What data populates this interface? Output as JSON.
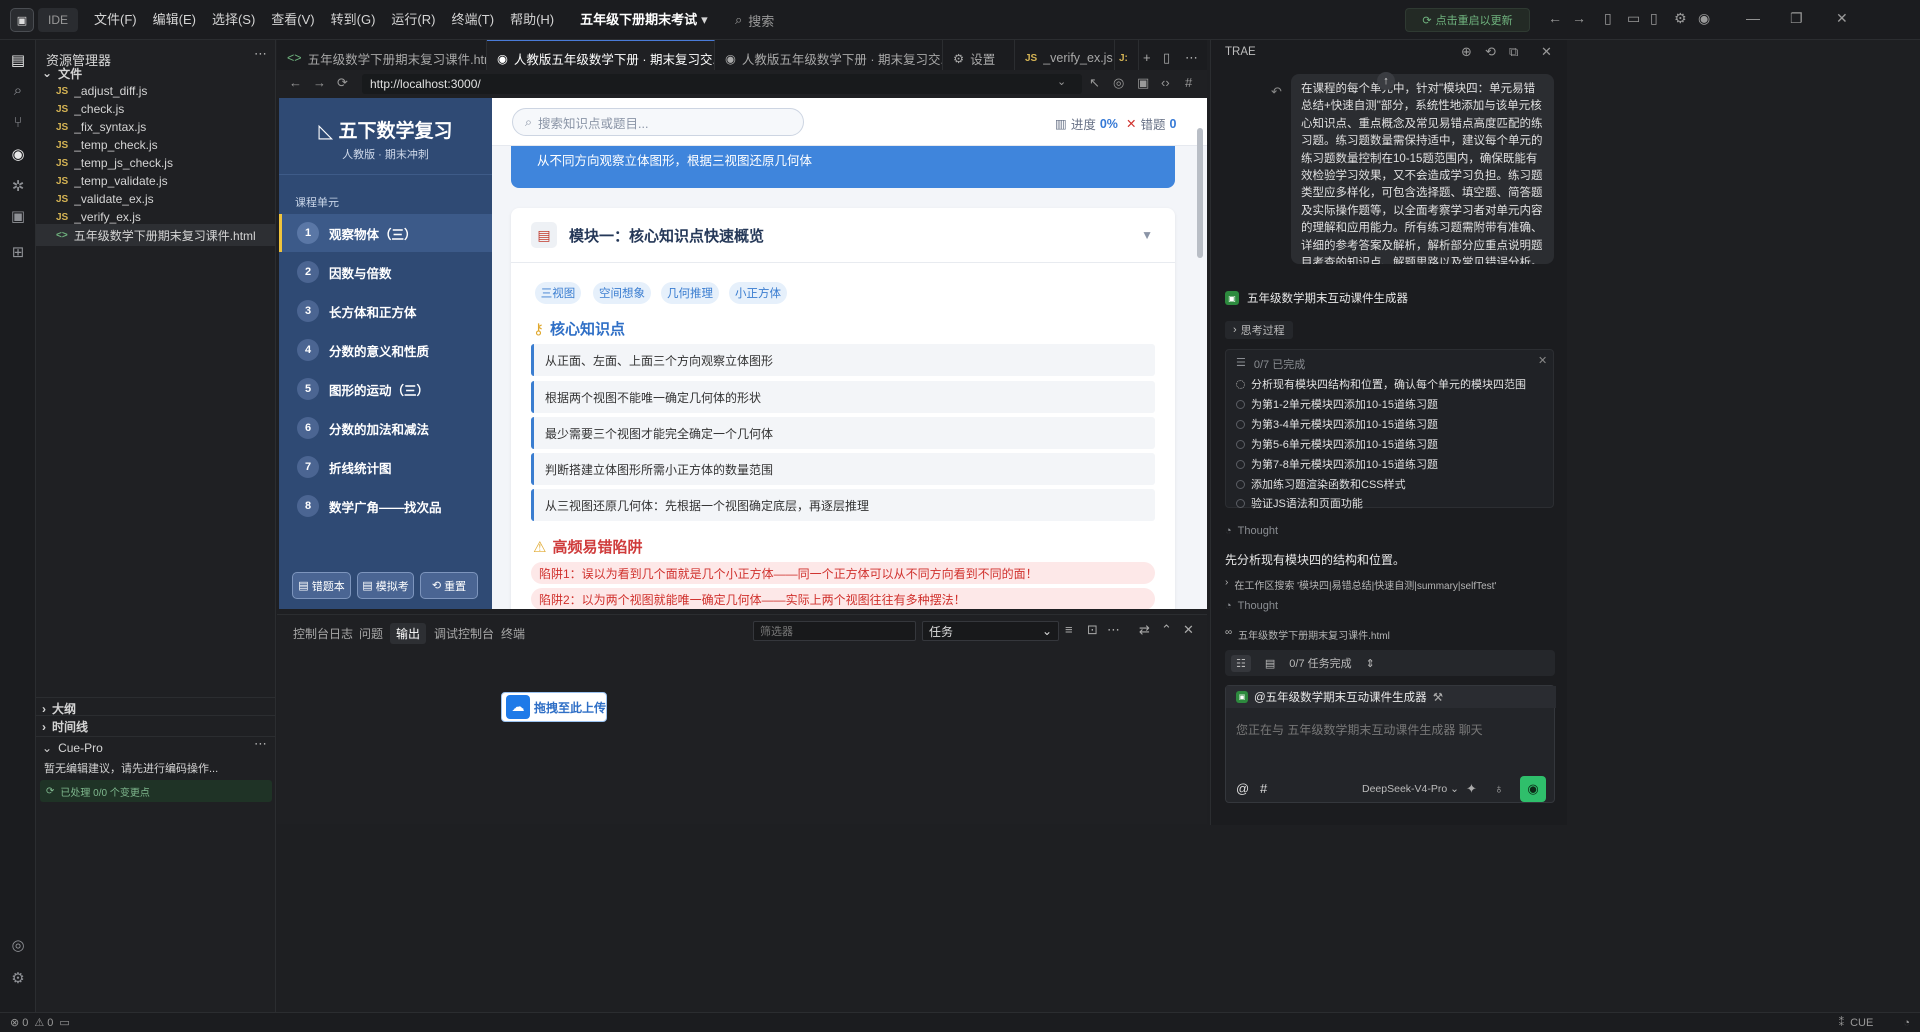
{
  "titlebar": {
    "logo": "▣",
    "ide_label": "IDE",
    "menu": [
      "文件(F)",
      "编辑(E)",
      "选择(S)",
      "查看(V)",
      "转到(G)",
      "运行(R)",
      "终端(T)",
      "帮助(H)"
    ],
    "workspace": "五年级下册期末考试",
    "search_placeholder": "搜索",
    "update_label": "点击重启以更新"
  },
  "explorer": {
    "title": "资源管理器",
    "root": "文件",
    "files": [
      {
        "icon": "JS",
        "name": "_adjust_diff.js"
      },
      {
        "icon": "JS",
        "name": "_check.js"
      },
      {
        "icon": "JS",
        "name": "_fix_syntax.js"
      },
      {
        "icon": "JS",
        "name": "_temp_check.js"
      },
      {
        "icon": "JS",
        "name": "_temp_js_check.js"
      },
      {
        "icon": "JS",
        "name": "_temp_validate.js"
      },
      {
        "icon": "JS",
        "name": "_validate_ex.js"
      },
      {
        "icon": "JS",
        "name": "_verify_ex.js"
      },
      {
        "icon": "<>",
        "name": "五年级数学下册期末复习课件.html"
      }
    ],
    "outline": "大纲",
    "timeline": "时间线",
    "cue_pro": "Cue-Pro",
    "cue_text": "暂无编辑建议，请先进行编码操作...",
    "cue_status": "已处理 0/0 个变更点"
  },
  "tabs": [
    {
      "icon": "<>",
      "label": "五年级数学下册期末复习课件.html"
    },
    {
      "icon": "◉",
      "label": "人教版五年级数学下册 · 期末复习交..."
    },
    {
      "icon": "◉",
      "label": "人教版五年级数学下册 · 期末复习交..."
    },
    {
      "icon": "⚙",
      "label": "设置"
    },
    {
      "icon": "JS",
      "label": "_verify_ex.js"
    },
    {
      "icon": "J:",
      "label": ""
    }
  ],
  "browser": {
    "url": "http://localhost:3000/"
  },
  "web": {
    "brand": "五下数学复习",
    "brand_sub": "人教版 · 期末冲刺",
    "units_heading": "课程单元",
    "units": [
      {
        "num": "1",
        "label": "观察物体（三）"
      },
      {
        "num": "2",
        "label": "因数与倍数"
      },
      {
        "num": "3",
        "label": "长方体和正方体"
      },
      {
        "num": "4",
        "label": "分数的意义和性质"
      },
      {
        "num": "5",
        "label": "图形的运动（三）"
      },
      {
        "num": "6",
        "label": "分数的加法和减法"
      },
      {
        "num": "7",
        "label": "折线统计图"
      },
      {
        "num": "8",
        "label": "数学广角——找次品"
      }
    ],
    "buttons": [
      "错题本",
      "模拟考",
      "重置"
    ],
    "search_placeholder": "搜索知识点或题目...",
    "progress_label": "进度",
    "progress_value": "0%",
    "wrong_label": "错题",
    "wrong_value": "0",
    "banner_text": "从不同方向观察立体图形，根据三视图还原几何体",
    "module_title": "模块一：核心知识点快速概览",
    "tags": [
      "三视图",
      "空间想象",
      "几何推理",
      "小正方体"
    ],
    "kp_title": "核心知识点",
    "knowledge_points": [
      "从正面、左面、上面三个方向观察立体图形",
      "根据两个视图不能唯一确定几何体的形状",
      "最少需要三个视图才能完全确定一个几何体",
      "判断搭建立体图形所需小正方体的数量范围",
      "从三视图还原几何体：先根据一个视图确定底层，再逐层推理"
    ],
    "trap_title": "高频易错陷阱",
    "traps": [
      "陷阱1：误以为看到几个面就是几个小正方体——同一个正方体可以从不同方向看到不同的面！",
      "陷阱2：以为两个视图就能唯一确定几何体——实际上两个视图往往有多种摆法！"
    ]
  },
  "panel": {
    "tabs": [
      "控制台日志",
      "问题",
      "输出",
      "调试控制台",
      "终端"
    ],
    "filter_placeholder": "筛选器",
    "select_value": "任务",
    "upload_label": "拖拽至此上传"
  },
  "right_panel": {
    "title": "TRAE",
    "user_message": "在课程的每个单元中，针对\"模块四：单元易错总结+快速自测\"部分，系统性地添加与该单元核心知识点、重点概念及常见易错点高度匹配的练习题。练习题数量需保持适中，建议每个单元的练习题数量控制在10-15题范围内，确保既能有效检验学习效果，又不会造成学习负担。练习题类型应多样化，可包含选择题、填空题、简答题及实际操作题等，以全面考察学习者对单元内容的理解和应用能力。所有练习题需附带有准确、详细的参考答案及解析，解析部分应重点说明题目考查的知识点、解题思路以及常见错误分析。",
    "agent_name": "五年级数学期末互动课件生成器",
    "think_label": "思考过程",
    "todo_header": "0/7 已完成",
    "todos": [
      "分析现有模块四结构和位置，确认每个单元的模块四范围",
      "为第1-2单元模块四添加10-15道练习题",
      "为第3-4单元模块四添加10-15道练习题",
      "为第5-6单元模块四添加10-15道练习题",
      "为第7-8单元模块四添加10-15道练习题",
      "添加练习题渲染函数和CSS样式",
      "验证JS语法和页面功能"
    ],
    "thought_label": "Thought",
    "analysis_text": "先分析现有模块四的结构和位置。",
    "search_step": "在工作区搜索 '模块四|易错总结|快速自测|summary|selfTest'",
    "file_ref": "五年级数学下册期末复习课件.html",
    "task_progress": "0/7 任务完成",
    "chat_mention": "@五年级数学期末互动课件生成器",
    "chat_placeholder": "您正在与 五年级数学期末互动课件生成器 聊天",
    "model": "DeepSeek-V4-Pro"
  },
  "status": {
    "errors": "0",
    "warnings": "0",
    "cue": "CUE"
  }
}
